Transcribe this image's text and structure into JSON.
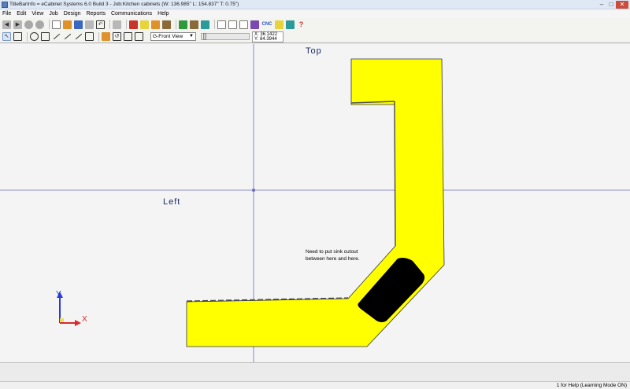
{
  "window": {
    "title": "TitleBarInfo = eCabinet Systems 6.0 Build 3 - Job:Kitchen cabinets (W: 136.985\" L: 154.837\" T: 0.75\")",
    "buttons": {
      "minimize": "–",
      "maximize": "□",
      "close": "✕"
    }
  },
  "menu": [
    "File",
    "Edit",
    "View",
    "Job",
    "Design",
    "Reports",
    "Communications",
    "Help"
  ],
  "toolbar1": {
    "cnc_label": "CNC",
    "help_label": "?"
  },
  "toolbar2": {
    "view_select": "G-Front View",
    "coords": {
      "x": "X: 36.1422",
      "y": "Y: 84.3944"
    }
  },
  "canvas": {
    "view_top": "Top",
    "view_left": "Left",
    "note_line1": "Need to put sink cutout",
    "note_line2": "between here and here.",
    "axis_y": "Y",
    "axis_x": "X"
  },
  "status": {
    "text": "1 for Help (Learning Mode ON)"
  },
  "colors": {
    "countertop_fill": "#ffff00",
    "sink_fill": "#000000",
    "crosshair": "#6b6bc0"
  }
}
